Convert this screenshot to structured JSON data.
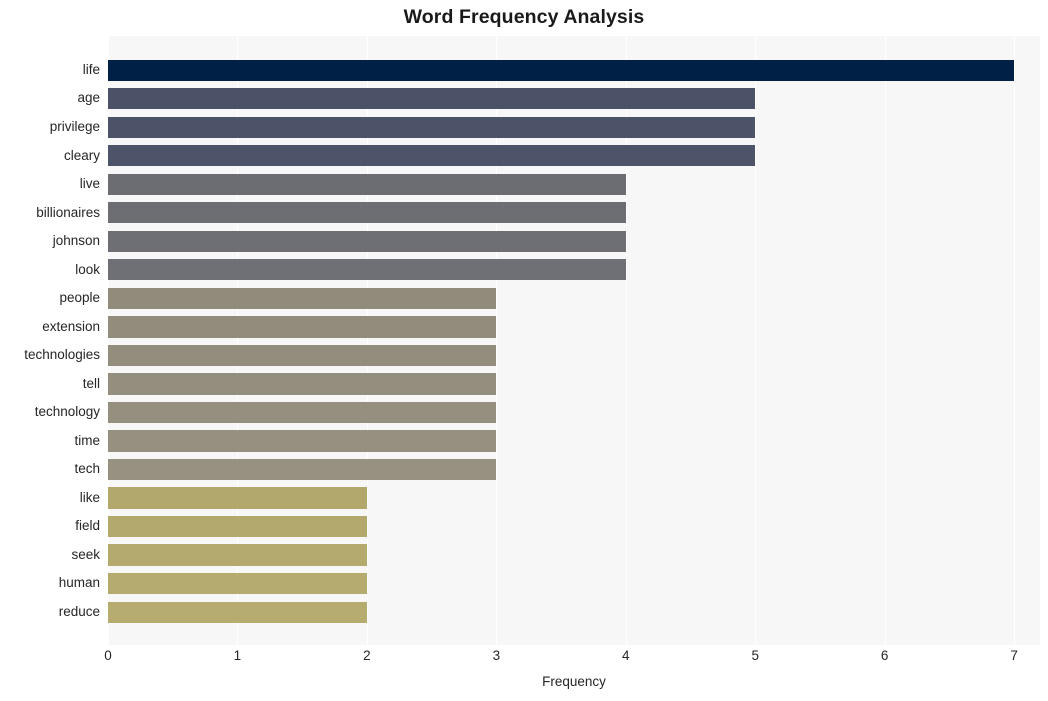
{
  "chart_data": {
    "type": "bar",
    "orientation": "horizontal",
    "title": "Word Frequency Analysis",
    "xlabel": "Frequency",
    "ylabel": "",
    "xlim": [
      0,
      7.2
    ],
    "xticks": [
      "0",
      "1",
      "2",
      "3",
      "4",
      "5",
      "6",
      "7"
    ],
    "xtick_values": [
      0,
      1,
      2,
      3,
      4,
      5,
      6,
      7
    ],
    "grid": "vertical-only",
    "legend": "none",
    "categories": [
      "life",
      "age",
      "privilege",
      "cleary",
      "live",
      "billionaires",
      "johnson",
      "look",
      "people",
      "extension",
      "technologies",
      "tell",
      "technology",
      "time",
      "tech",
      "like",
      "field",
      "seek",
      "human",
      "reduce"
    ],
    "values": [
      7,
      5,
      5,
      5,
      4,
      4,
      4,
      4,
      3,
      3,
      3,
      3,
      3,
      3,
      3,
      2,
      2,
      2,
      2,
      2
    ],
    "bar_colors": [
      "#012046",
      "#4b5167",
      "#4c5268",
      "#4d5369",
      "#6b6d73",
      "#6c6e74",
      "#6d6f75",
      "#6e7076",
      "#918b7b",
      "#928c7c",
      "#938d7d",
      "#948e7e",
      "#958f7f",
      "#969080",
      "#979181",
      "#b2a86b",
      "#b3a96c",
      "#b4aa6d",
      "#b5ab6e",
      "#b6ac6f"
    ],
    "plot_background": "#f7f7f8",
    "figure_background": "#ffffff",
    "gridline_color": "#ffffff",
    "text_color": "#262626"
  }
}
